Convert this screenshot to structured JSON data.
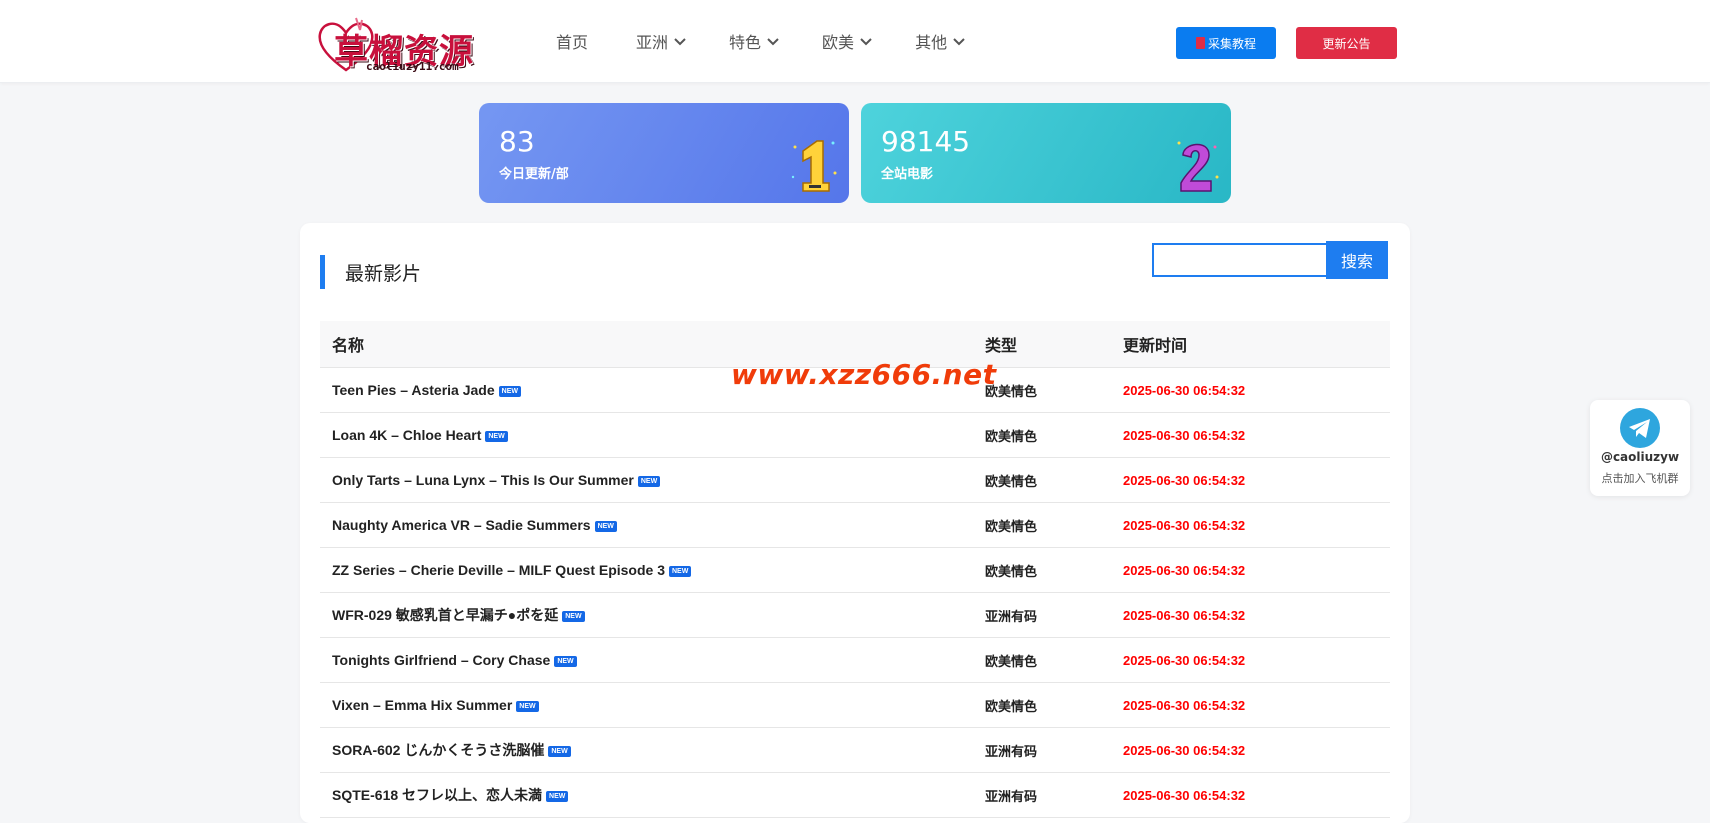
{
  "header": {
    "logo_text": "草榴资源",
    "logo_sub": "caoliuzy11.com",
    "nav": [
      {
        "label": "首页",
        "has_dropdown": false
      },
      {
        "label": "亚洲",
        "has_dropdown": true
      },
      {
        "label": "特色",
        "has_dropdown": true
      },
      {
        "label": "欧美",
        "has_dropdown": true
      },
      {
        "label": "其他",
        "has_dropdown": true
      }
    ],
    "guide_button": "采集教程",
    "notice_button": "更新公告"
  },
  "stats": [
    {
      "value": "83",
      "label": "今日更新/部",
      "badge_icon": "rank-1-icon"
    },
    {
      "value": "98145",
      "label": "全站电影",
      "badge_icon": "rank-2-icon"
    }
  ],
  "main": {
    "section_title": "最新影片",
    "search": {
      "value": "",
      "placeholder": "",
      "button": "搜索"
    },
    "columns": {
      "name": "名称",
      "type": "类型",
      "time": "更新时间"
    },
    "new_label": "NEW",
    "rows": [
      {
        "name": "Teen Pies – Asteria Jade",
        "type": "欧美情色",
        "time": "2025-06-30 06:54:32"
      },
      {
        "name": "Loan 4K – Chloe Heart",
        "type": "欧美情色",
        "time": "2025-06-30 06:54:32"
      },
      {
        "name": "Only Tarts – Luna Lynx – This Is Our Summer",
        "type": "欧美情色",
        "time": "2025-06-30 06:54:32"
      },
      {
        "name": "Naughty America VR – Sadie Summers",
        "type": "欧美情色",
        "time": "2025-06-30 06:54:32"
      },
      {
        "name": "ZZ Series – Cherie Deville – MILF Quest Episode 3",
        "type": "欧美情色",
        "time": "2025-06-30 06:54:32"
      },
      {
        "name": "WFR-029 敏感乳首と早漏チ●ポを延",
        "type": "亚洲有码",
        "time": "2025-06-30 06:54:32"
      },
      {
        "name": "Tonights Girlfriend – Cory Chase",
        "type": "欧美情色",
        "time": "2025-06-30 06:54:32"
      },
      {
        "name": "Vixen – Emma Hix Summer",
        "type": "欧美情色",
        "time": "2025-06-30 06:54:32"
      },
      {
        "name": "SORA-602 じんかくそうさ洗脳催",
        "type": "亚洲有码",
        "time": "2025-06-30 06:54:32"
      },
      {
        "name": "SQTE-618 セフレ以上、恋人未満",
        "type": "亚洲有码",
        "time": "2025-06-30 06:54:32"
      }
    ]
  },
  "watermark": "www.xzz666.net",
  "telegram": {
    "handle": "@caoliuzyw",
    "text": "点击加入飞机群",
    "icon": "telegram-icon"
  },
  "colors": {
    "accent": "#1e7df0",
    "danger": "#e02d45",
    "time_red": "#ff0000",
    "watermark": "#f03c0a"
  }
}
